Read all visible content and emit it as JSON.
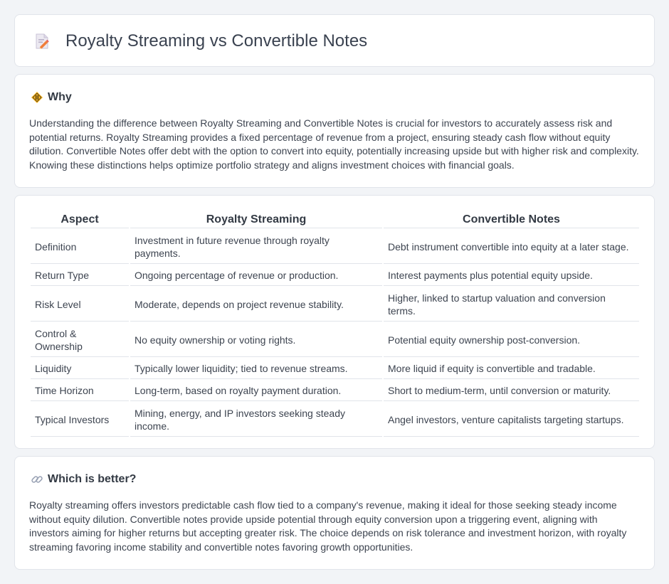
{
  "header": {
    "title": "Royalty Streaming vs Convertible Notes",
    "icon": "document-pencil-icon"
  },
  "why": {
    "heading": "Why",
    "icon": "diamond-sign-icon",
    "text": "Understanding the difference between Royalty Streaming and Convertible Notes is crucial for investors to accurately assess risk and potential returns. Royalty Streaming provides a fixed percentage of revenue from a project, ensuring steady cash flow without equity dilution. Convertible Notes offer debt with the option to convert into equity, potentially increasing upside but with higher risk and complexity. Knowing these distinctions helps optimize portfolio strategy and aligns investment choices with financial goals."
  },
  "table": {
    "headers": [
      "Aspect",
      "Royalty Streaming",
      "Convertible Notes"
    ],
    "rows": [
      [
        "Definition",
        "Investment in future revenue through royalty payments.",
        "Debt instrument convertible into equity at a later stage."
      ],
      [
        "Return Type",
        "Ongoing percentage of revenue or production.",
        "Interest payments plus potential equity upside."
      ],
      [
        "Risk Level",
        "Moderate, depends on project revenue stability.",
        "Higher, linked to startup valuation and conversion terms."
      ],
      [
        "Control & Ownership",
        "No equity ownership or voting rights.",
        "Potential equity ownership post-conversion."
      ],
      [
        "Liquidity",
        "Typically lower liquidity; tied to revenue streams.",
        "More liquid if equity is convertible and tradable."
      ],
      [
        "Time Horizon",
        "Long-term, based on royalty payment duration.",
        "Short to medium-term, until conversion or maturity."
      ],
      [
        "Typical Investors",
        "Mining, energy, and IP investors seeking steady income.",
        "Angel investors, venture capitalists targeting startups."
      ]
    ]
  },
  "better": {
    "heading": "Which is better?",
    "icon": "link-icon",
    "text": "Royalty streaming offers investors predictable cash flow tied to a company's revenue, making it ideal for those seeking steady income without equity dilution. Convertible notes provide upside potential through equity conversion upon a triggering event, aligning with investors aiming for higher returns but accepting greater risk. The choice depends on risk tolerance and investment horizon, with royalty streaming favoring income stability and convertible notes favoring growth opportunities."
  }
}
